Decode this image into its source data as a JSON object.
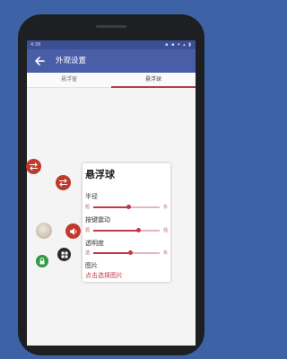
{
  "statusbar": {
    "time": "4:38",
    "icons": "▪ ▪ ▾ ▴ ▮"
  },
  "header": {
    "title": "外观设置"
  },
  "tabs": [
    {
      "label": "悬浮窗"
    },
    {
      "label": "悬浮球",
      "selected": true
    }
  ],
  "settings": {
    "title": "悬浮球",
    "radius": {
      "label": "半径",
      "min_label": "短",
      "max_label": "长",
      "value": 0.53
    },
    "vibration": {
      "label": "按键震动",
      "min_label": "弱",
      "max_label": "强",
      "value": 0.68
    },
    "opacity": {
      "label": "透明度",
      "min_label": "透",
      "max_label": "实",
      "value": 0.56
    },
    "image": {
      "label": "图片",
      "link": "点击选择图片"
    }
  },
  "colors": {
    "accent": "#c0394b",
    "appbar": "#4a5ea8",
    "background": "#3d63a6"
  },
  "floating_buttons": [
    "swap-icon",
    "swap-icon",
    "avatar",
    "volume-icon",
    "lock-icon",
    "grid-icon"
  ]
}
